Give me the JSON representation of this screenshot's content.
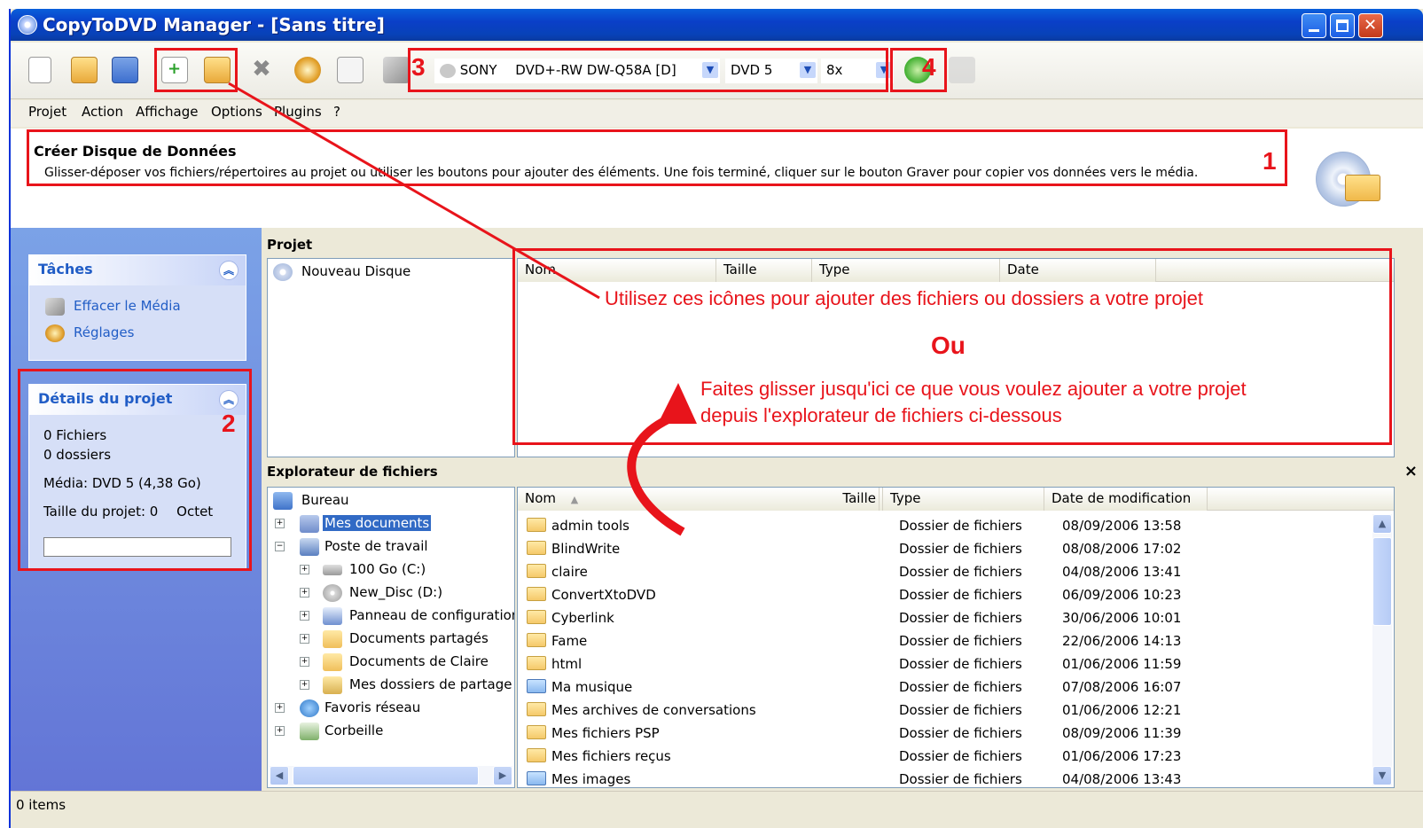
{
  "window": {
    "title": "CopyToDVD Manager - [Sans titre]"
  },
  "drive": {
    "name": "SONY",
    "model": "DVD+-RW DW-Q58A  [D]"
  },
  "media": {
    "type": "DVD 5",
    "speed": "8x"
  },
  "menu": [
    "Projet",
    "Action",
    "Affichage",
    "Options",
    "Plugins",
    "?"
  ],
  "banner": {
    "title": "Créer Disque de Données",
    "text": "Glisser-déposer vos fichiers/répertoires au projet ou utiliser les boutons pour ajouter des éléments. Une fois terminé, cliquer sur le bouton Graver pour copier vos données vers le média."
  },
  "tasks": {
    "title": "Tâches",
    "items": [
      "Effacer le Média",
      "Réglages"
    ]
  },
  "details": {
    "title": "Détails du projet",
    "files": "0 Fichiers",
    "folders": "0 dossiers",
    "media": "Média: DVD 5 (4,38 Go)",
    "size_label": "Taille du projet: 0",
    "size_unit": "Octet",
    "progress": 0
  },
  "project": {
    "label": "Projet",
    "root": "Nouveau Disque",
    "columns": [
      "Nom",
      "Taille",
      "Type",
      "Date"
    ]
  },
  "annotations": {
    "n1": "1",
    "n2": "2",
    "n3": "3",
    "n4": "4",
    "line1": "Utilisez ces icônes pour ajouter des fichiers ou dossiers a votre projet",
    "or": "Ou",
    "line2": "Faites glisser jusqu'ici ce que vous voulez ajouter a votre projet",
    "line3": "depuis l'explorateur de fichiers ci-dessous",
    "color": "#e8141b"
  },
  "explorer": {
    "label": "Explorateur de fichiers",
    "close": "×",
    "tree": [
      {
        "label": "Bureau"
      },
      {
        "label": "Mes documents"
      },
      {
        "label": "Poste de travail"
      },
      {
        "label": "100 Go (C:)"
      },
      {
        "label": "New_Disc (D:)"
      },
      {
        "label": "Panneau de configuration"
      },
      {
        "label": "Documents partagés"
      },
      {
        "label": "Documents de Claire"
      },
      {
        "label": "Mes dossiers de partage"
      },
      {
        "label": "Favoris réseau"
      },
      {
        "label": "Corbeille"
      }
    ],
    "columns": [
      "Nom",
      "Taille",
      "Type",
      "Date de modification"
    ],
    "files": [
      {
        "name": "admin tools",
        "type": "Dossier de fichiers",
        "date": "08/09/2006 13:58"
      },
      {
        "name": "BlindWrite",
        "type": "Dossier de fichiers",
        "date": "08/08/2006 17:02"
      },
      {
        "name": "claire",
        "type": "Dossier de fichiers",
        "date": "04/08/2006 13:41"
      },
      {
        "name": "ConvertXtoDVD",
        "type": "Dossier de fichiers",
        "date": "06/09/2006 10:23"
      },
      {
        "name": "Cyberlink",
        "type": "Dossier de fichiers",
        "date": "30/06/2006 10:01"
      },
      {
        "name": "Fame",
        "type": "Dossier de fichiers",
        "date": "22/06/2006 14:13"
      },
      {
        "name": "html",
        "type": "Dossier de fichiers",
        "date": "01/06/2006 11:59"
      },
      {
        "name": "Ma musique",
        "type": "Dossier de fichiers",
        "date": "07/08/2006 16:07"
      },
      {
        "name": "Mes archives de conversations",
        "type": "Dossier de fichiers",
        "date": "01/06/2006 12:21"
      },
      {
        "name": "Mes fichiers PSP",
        "type": "Dossier de fichiers",
        "date": "08/09/2006 11:39"
      },
      {
        "name": "Mes fichiers reçus",
        "type": "Dossier de fichiers",
        "date": "01/06/2006 17:23"
      },
      {
        "name": "Mes images",
        "type": "Dossier de fichiers",
        "date": "04/08/2006 13:43"
      }
    ]
  },
  "status": {
    "text": "0 items"
  }
}
